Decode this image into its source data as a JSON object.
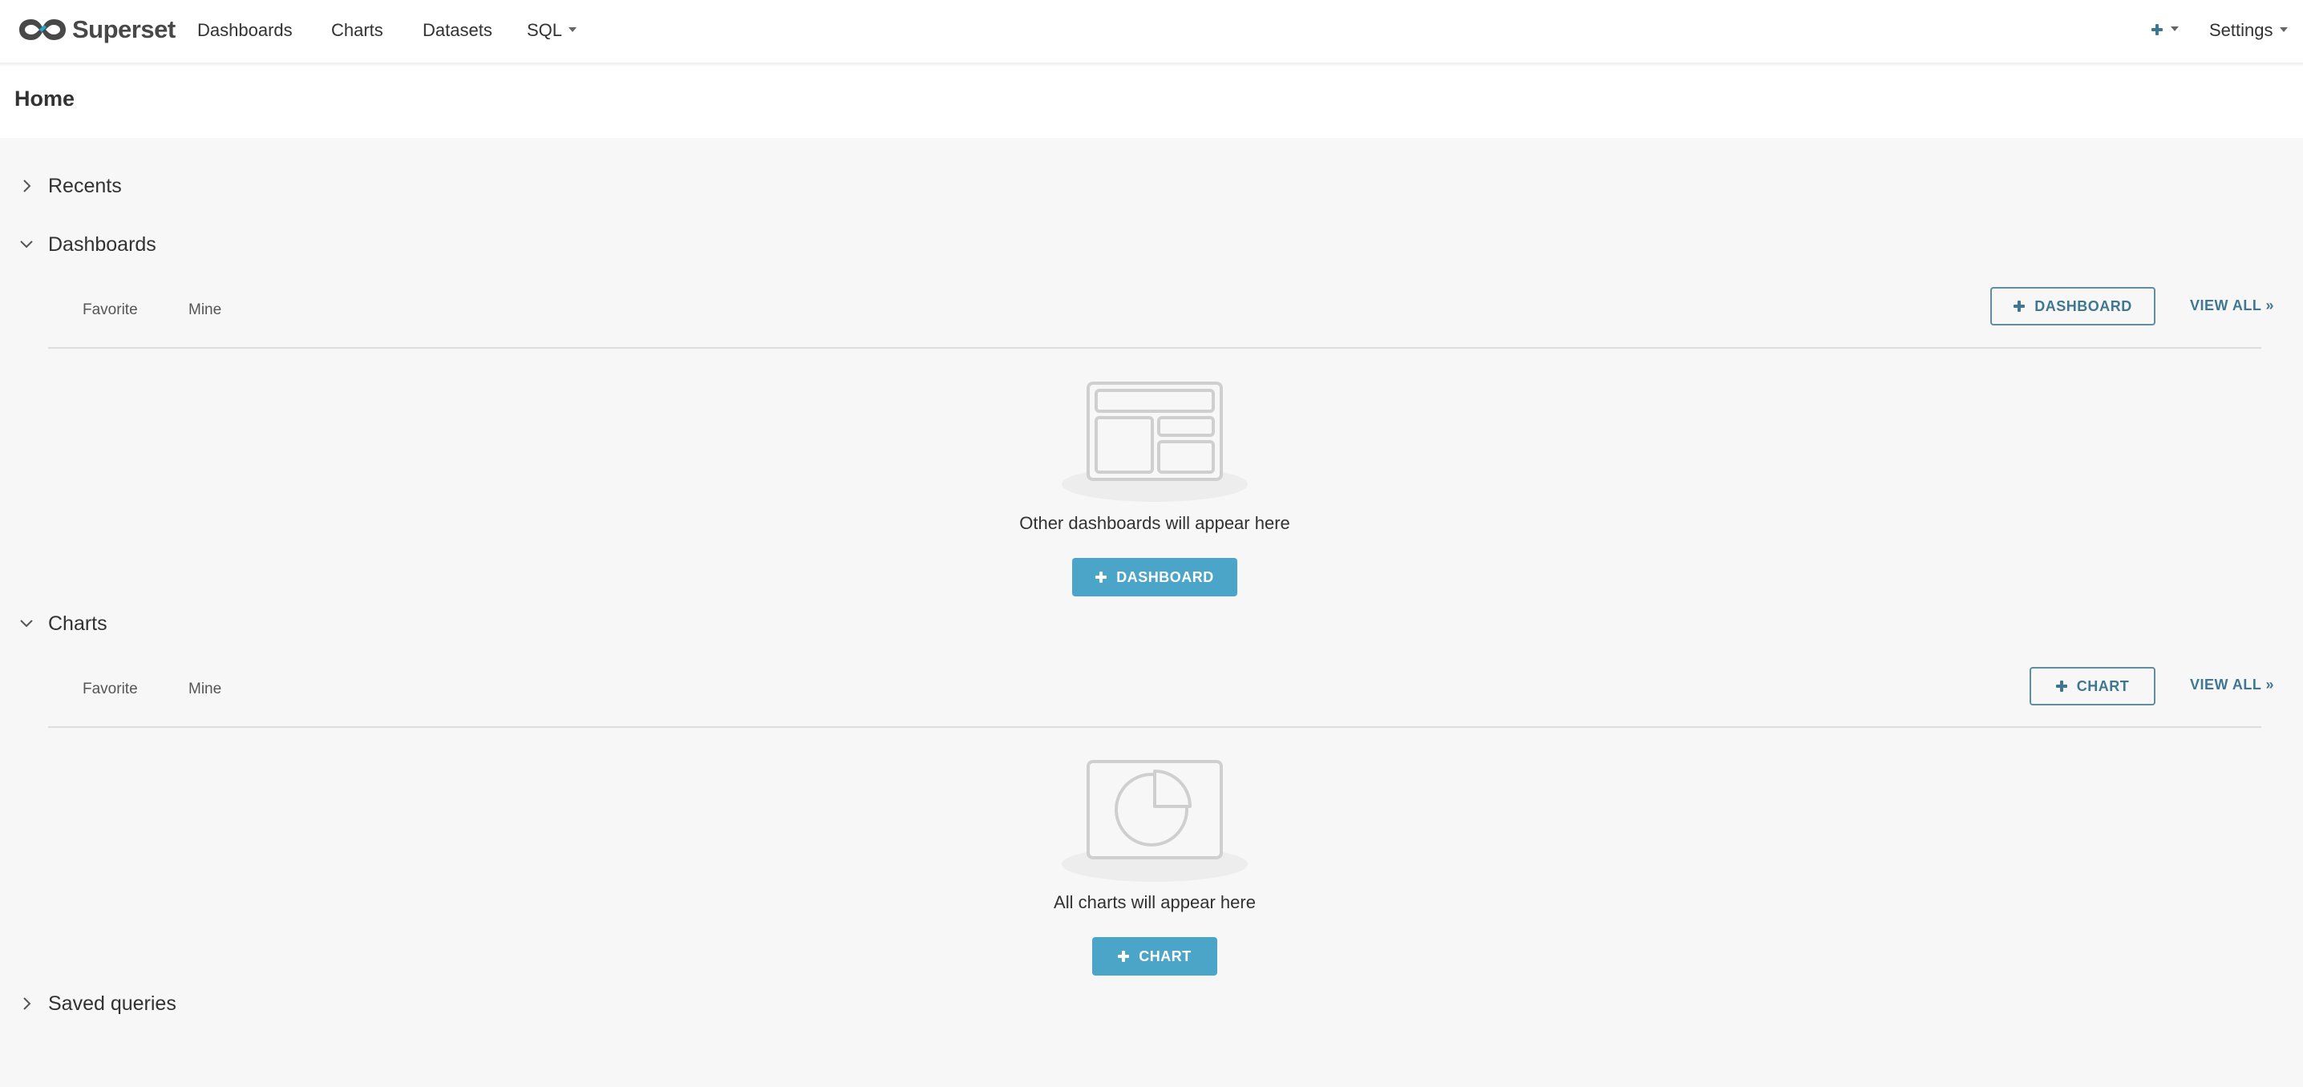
{
  "navbar": {
    "brand": "Superset",
    "items": [
      {
        "label": "Dashboards"
      },
      {
        "label": "Charts"
      },
      {
        "label": "Datasets"
      },
      {
        "label": "SQL"
      }
    ],
    "settings_label": "Settings",
    "icons": {
      "logo": "superset-infinity-logo",
      "add": "plus-icon",
      "caret": "caret-down-icon"
    }
  },
  "page": {
    "title": "Home"
  },
  "sections": {
    "recents": {
      "title": "Recents",
      "expanded": false
    },
    "dashboards": {
      "title": "Dashboards",
      "expanded": true,
      "tabs": [
        "Favorite",
        "Mine"
      ],
      "add_button": "DASHBOARD",
      "view_all": "VIEW ALL »",
      "empty_text": "Other dashboards will appear here",
      "empty_button": "DASHBOARD"
    },
    "charts": {
      "title": "Charts",
      "expanded": true,
      "tabs": [
        "Favorite",
        "Mine"
      ],
      "add_button": "CHART",
      "view_all": "VIEW ALL »",
      "empty_text": "All charts will appear here",
      "empty_button": "CHART"
    },
    "saved_queries": {
      "title": "Saved queries",
      "expanded": false
    }
  },
  "colors": {
    "accent": "#4ba5c8",
    "accent_text": "#3f7792",
    "background": "#f7f7f7",
    "surface": "#ffffff"
  }
}
